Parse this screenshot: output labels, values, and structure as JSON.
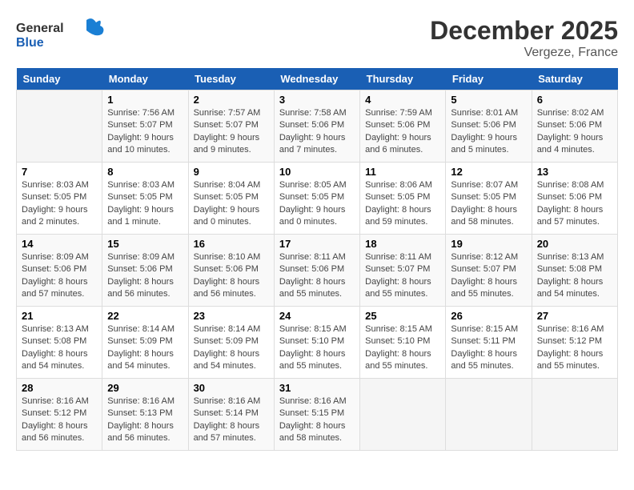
{
  "header": {
    "logo_general": "General",
    "logo_blue": "Blue",
    "title": "December 2025",
    "location": "Vergeze, France"
  },
  "calendar": {
    "weekdays": [
      "Sunday",
      "Monday",
      "Tuesday",
      "Wednesday",
      "Thursday",
      "Friday",
      "Saturday"
    ],
    "weeks": [
      [
        {
          "day": "",
          "sunrise": "",
          "sunset": "",
          "daylight": ""
        },
        {
          "day": "1",
          "sunrise": "Sunrise: 7:56 AM",
          "sunset": "Sunset: 5:07 PM",
          "daylight": "Daylight: 9 hours and 10 minutes."
        },
        {
          "day": "2",
          "sunrise": "Sunrise: 7:57 AM",
          "sunset": "Sunset: 5:07 PM",
          "daylight": "Daylight: 9 hours and 9 minutes."
        },
        {
          "day": "3",
          "sunrise": "Sunrise: 7:58 AM",
          "sunset": "Sunset: 5:06 PM",
          "daylight": "Daylight: 9 hours and 7 minutes."
        },
        {
          "day": "4",
          "sunrise": "Sunrise: 7:59 AM",
          "sunset": "Sunset: 5:06 PM",
          "daylight": "Daylight: 9 hours and 6 minutes."
        },
        {
          "day": "5",
          "sunrise": "Sunrise: 8:01 AM",
          "sunset": "Sunset: 5:06 PM",
          "daylight": "Daylight: 9 hours and 5 minutes."
        },
        {
          "day": "6",
          "sunrise": "Sunrise: 8:02 AM",
          "sunset": "Sunset: 5:06 PM",
          "daylight": "Daylight: 9 hours and 4 minutes."
        }
      ],
      [
        {
          "day": "7",
          "sunrise": "Sunrise: 8:03 AM",
          "sunset": "Sunset: 5:05 PM",
          "daylight": "Daylight: 9 hours and 2 minutes."
        },
        {
          "day": "8",
          "sunrise": "Sunrise: 8:03 AM",
          "sunset": "Sunset: 5:05 PM",
          "daylight": "Daylight: 9 hours and 1 minute."
        },
        {
          "day": "9",
          "sunrise": "Sunrise: 8:04 AM",
          "sunset": "Sunset: 5:05 PM",
          "daylight": "Daylight: 9 hours and 0 minutes."
        },
        {
          "day": "10",
          "sunrise": "Sunrise: 8:05 AM",
          "sunset": "Sunset: 5:05 PM",
          "daylight": "Daylight: 9 hours and 0 minutes."
        },
        {
          "day": "11",
          "sunrise": "Sunrise: 8:06 AM",
          "sunset": "Sunset: 5:05 PM",
          "daylight": "Daylight: 8 hours and 59 minutes."
        },
        {
          "day": "12",
          "sunrise": "Sunrise: 8:07 AM",
          "sunset": "Sunset: 5:05 PM",
          "daylight": "Daylight: 8 hours and 58 minutes."
        },
        {
          "day": "13",
          "sunrise": "Sunrise: 8:08 AM",
          "sunset": "Sunset: 5:06 PM",
          "daylight": "Daylight: 8 hours and 57 minutes."
        }
      ],
      [
        {
          "day": "14",
          "sunrise": "Sunrise: 8:09 AM",
          "sunset": "Sunset: 5:06 PM",
          "daylight": "Daylight: 8 hours and 57 minutes."
        },
        {
          "day": "15",
          "sunrise": "Sunrise: 8:09 AM",
          "sunset": "Sunset: 5:06 PM",
          "daylight": "Daylight: 8 hours and 56 minutes."
        },
        {
          "day": "16",
          "sunrise": "Sunrise: 8:10 AM",
          "sunset": "Sunset: 5:06 PM",
          "daylight": "Daylight: 8 hours and 56 minutes."
        },
        {
          "day": "17",
          "sunrise": "Sunrise: 8:11 AM",
          "sunset": "Sunset: 5:06 PM",
          "daylight": "Daylight: 8 hours and 55 minutes."
        },
        {
          "day": "18",
          "sunrise": "Sunrise: 8:11 AM",
          "sunset": "Sunset: 5:07 PM",
          "daylight": "Daylight: 8 hours and 55 minutes."
        },
        {
          "day": "19",
          "sunrise": "Sunrise: 8:12 AM",
          "sunset": "Sunset: 5:07 PM",
          "daylight": "Daylight: 8 hours and 55 minutes."
        },
        {
          "day": "20",
          "sunrise": "Sunrise: 8:13 AM",
          "sunset": "Sunset: 5:08 PM",
          "daylight": "Daylight: 8 hours and 54 minutes."
        }
      ],
      [
        {
          "day": "21",
          "sunrise": "Sunrise: 8:13 AM",
          "sunset": "Sunset: 5:08 PM",
          "daylight": "Daylight: 8 hours and 54 minutes."
        },
        {
          "day": "22",
          "sunrise": "Sunrise: 8:14 AM",
          "sunset": "Sunset: 5:09 PM",
          "daylight": "Daylight: 8 hours and 54 minutes."
        },
        {
          "day": "23",
          "sunrise": "Sunrise: 8:14 AM",
          "sunset": "Sunset: 5:09 PM",
          "daylight": "Daylight: 8 hours and 54 minutes."
        },
        {
          "day": "24",
          "sunrise": "Sunrise: 8:15 AM",
          "sunset": "Sunset: 5:10 PM",
          "daylight": "Daylight: 8 hours and 55 minutes."
        },
        {
          "day": "25",
          "sunrise": "Sunrise: 8:15 AM",
          "sunset": "Sunset: 5:10 PM",
          "daylight": "Daylight: 8 hours and 55 minutes."
        },
        {
          "day": "26",
          "sunrise": "Sunrise: 8:15 AM",
          "sunset": "Sunset: 5:11 PM",
          "daylight": "Daylight: 8 hours and 55 minutes."
        },
        {
          "day": "27",
          "sunrise": "Sunrise: 8:16 AM",
          "sunset": "Sunset: 5:12 PM",
          "daylight": "Daylight: 8 hours and 55 minutes."
        }
      ],
      [
        {
          "day": "28",
          "sunrise": "Sunrise: 8:16 AM",
          "sunset": "Sunset: 5:12 PM",
          "daylight": "Daylight: 8 hours and 56 minutes."
        },
        {
          "day": "29",
          "sunrise": "Sunrise: 8:16 AM",
          "sunset": "Sunset: 5:13 PM",
          "daylight": "Daylight: 8 hours and 56 minutes."
        },
        {
          "day": "30",
          "sunrise": "Sunrise: 8:16 AM",
          "sunset": "Sunset: 5:14 PM",
          "daylight": "Daylight: 8 hours and 57 minutes."
        },
        {
          "day": "31",
          "sunrise": "Sunrise: 8:16 AM",
          "sunset": "Sunset: 5:15 PM",
          "daylight": "Daylight: 8 hours and 58 minutes."
        },
        {
          "day": "",
          "sunrise": "",
          "sunset": "",
          "daylight": ""
        },
        {
          "day": "",
          "sunrise": "",
          "sunset": "",
          "daylight": ""
        },
        {
          "day": "",
          "sunrise": "",
          "sunset": "",
          "daylight": ""
        }
      ]
    ]
  }
}
